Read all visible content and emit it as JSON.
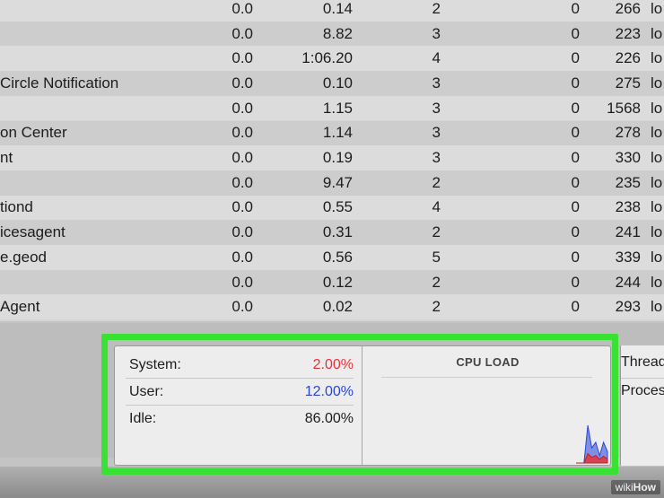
{
  "process_table": {
    "rows": [
      {
        "name": "",
        "cpu": "0.0",
        "cpu_time": "0.14",
        "threads": "2",
        "idle_wakeups": "0",
        "pid": "266",
        "user": "lo"
      },
      {
        "name": "",
        "cpu": "0.0",
        "cpu_time": "8.82",
        "threads": "3",
        "idle_wakeups": "0",
        "pid": "223",
        "user": "lo"
      },
      {
        "name": "",
        "cpu": "0.0",
        "cpu_time": "1:06.20",
        "threads": "4",
        "idle_wakeups": "0",
        "pid": "226",
        "user": "lo"
      },
      {
        "name": "Circle Notification",
        "cpu": "0.0",
        "cpu_time": "0.10",
        "threads": "3",
        "idle_wakeups": "0",
        "pid": "275",
        "user": "lo"
      },
      {
        "name": "",
        "cpu": "0.0",
        "cpu_time": "1.15",
        "threads": "3",
        "idle_wakeups": "0",
        "pid": "1568",
        "user": "lo"
      },
      {
        "name": "on Center",
        "cpu": "0.0",
        "cpu_time": "1.14",
        "threads": "3",
        "idle_wakeups": "0",
        "pid": "278",
        "user": "lo"
      },
      {
        "name": "nt",
        "cpu": "0.0",
        "cpu_time": "0.19",
        "threads": "3",
        "idle_wakeups": "0",
        "pid": "330",
        "user": "lo"
      },
      {
        "name": "",
        "cpu": "0.0",
        "cpu_time": "9.47",
        "threads": "2",
        "idle_wakeups": "0",
        "pid": "235",
        "user": "lo"
      },
      {
        "name": "tiond",
        "cpu": "0.0",
        "cpu_time": "0.55",
        "threads": "4",
        "idle_wakeups": "0",
        "pid": "238",
        "user": "lo"
      },
      {
        "name": "icesagent",
        "cpu": "0.0",
        "cpu_time": "0.31",
        "threads": "2",
        "idle_wakeups": "0",
        "pid": "241",
        "user": "lo"
      },
      {
        "name": "e.geod",
        "cpu": "0.0",
        "cpu_time": "0.56",
        "threads": "5",
        "idle_wakeups": "0",
        "pid": "339",
        "user": "lo"
      },
      {
        "name": "",
        "cpu": "0.0",
        "cpu_time": "0.12",
        "threads": "2",
        "idle_wakeups": "0",
        "pid": "244",
        "user": "lo"
      },
      {
        "name": "Agent",
        "cpu": "0.0",
        "cpu_time": "0.02",
        "threads": "2",
        "idle_wakeups": "0",
        "pid": "293",
        "user": "lo"
      }
    ]
  },
  "cpu_summary": {
    "system_label": "System:",
    "system_value": "2.00%",
    "user_label": "User:",
    "user_value": "12.00%",
    "idle_label": "Idle:",
    "idle_value": "86.00%",
    "system_color": "#e8323a",
    "user_color": "#2a45d8"
  },
  "cpu_load": {
    "title": "CPU LOAD",
    "user_series": [
      0,
      0,
      0,
      1,
      0.4,
      0.55,
      0.2,
      0.55,
      0.3
    ],
    "system_series": [
      0,
      0,
      0,
      0.25,
      0.15,
      0.2,
      0.1,
      0.18,
      0.1
    ]
  },
  "side_labels": {
    "threads": "Threads:",
    "processes": "Processes:"
  },
  "highlight_color": "#37e233",
  "watermark": {
    "prefix": "wiki",
    "suffix": "How"
  }
}
